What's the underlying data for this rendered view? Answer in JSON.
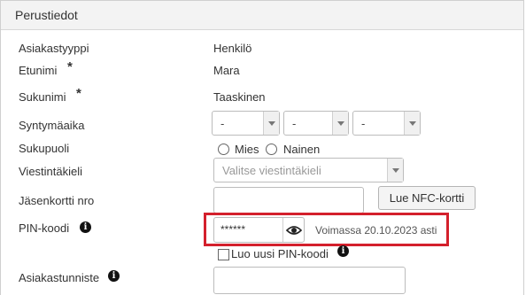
{
  "panel": {
    "title": "Perustiedot"
  },
  "fields": {
    "asiakastyyppi": {
      "label": "Asiakastyyppi",
      "value": "Henkilö"
    },
    "etunimi": {
      "label": "Etunimi",
      "required": "*",
      "value": "Mara"
    },
    "sukunimi": {
      "label": "Sukunimi",
      "required": "*",
      "value": "Taaskinen"
    },
    "syntymaaika": {
      "label": "Syntymäaika",
      "day": "-",
      "month": "-",
      "year": "-"
    },
    "sukupuoli": {
      "label": "Sukupuoli",
      "options": [
        "Mies",
        "Nainen"
      ]
    },
    "viestintakieli": {
      "label": "Viestintäkieli",
      "placeholder": "Valitse viestintäkieli"
    },
    "jasenkortti": {
      "label": "Jäsenkortti nro",
      "value": "",
      "button": "Lue NFC-kortti"
    },
    "pin": {
      "label": "PIN-koodi",
      "value": "******",
      "validity": "Voimassa 20.10.2023 asti",
      "new_pin_label": "Luo uusi PIN-koodi"
    },
    "asiakastunniste": {
      "label": "Asiakastunniste",
      "value": ""
    }
  },
  "icons": {
    "info": "info-icon",
    "eye": "eye-icon"
  },
  "colors": {
    "highlight": "#d4202c"
  }
}
